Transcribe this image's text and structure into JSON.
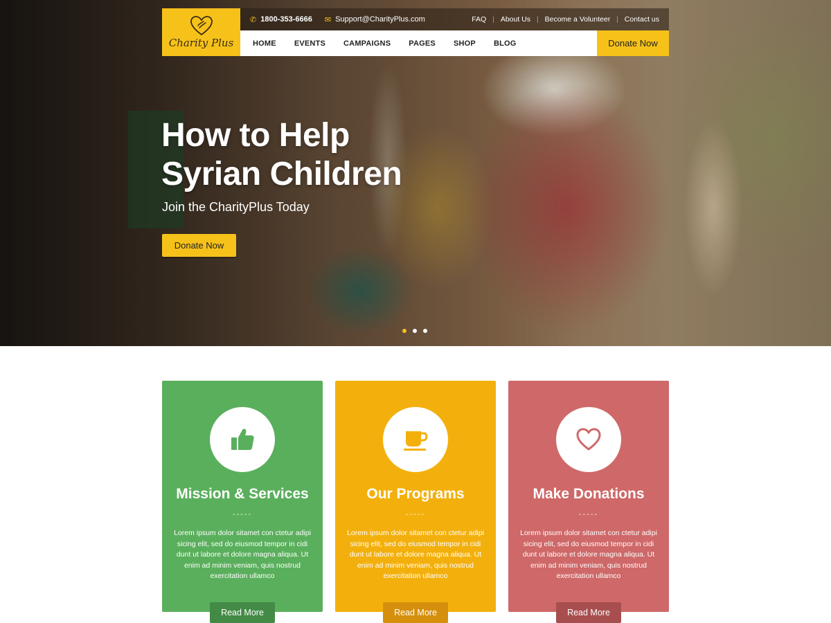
{
  "brand": {
    "logo_text": "Charity Plus",
    "accent_color": "#f6c21a"
  },
  "topbar": {
    "phone": "1800-353-6666",
    "email": "Support@CharityPlus.com",
    "links": [
      "FAQ",
      "About Us",
      "Become a Volunteer",
      "Contact us"
    ]
  },
  "nav": {
    "items": [
      "HOME",
      "EVENTS",
      "CAMPAIGNS",
      "PAGES",
      "SHOP",
      "BLOG"
    ],
    "donate_label": "Donate Now"
  },
  "hero": {
    "title_line1": "How to Help",
    "title_line2": "Syrian Children",
    "subtitle": "Join the CharityPlus Today",
    "button_label": "Donate Now",
    "slides_count": 3,
    "active_slide": 1
  },
  "cards": [
    {
      "title": "Mission & Services",
      "divider": "-----",
      "text": "Lorem ipsum dolor sitamet con ctetur adipi sicing elit, sed do eiusmod tempor in cidi dunt ut labore et dolore magna aliqua. Ut enim ad minim veniam, quis nostrud exercitation ullamco",
      "button_label": "Read More",
      "icon": "thumbs-up-icon",
      "color": "#5aaf5c"
    },
    {
      "title": "Our Programs",
      "divider": "-----",
      "text": "Lorem ipsum dolor sitamet con ctetur adipi sicing elit, sed do eiusmod tempor in cidi dunt ut labore et dolore magna aliqua. Ut enim ad minim veniam, quis nostrud exercitation ullamco",
      "button_label": "Read More",
      "icon": "coffee-cup-icon",
      "color": "#f3b00d"
    },
    {
      "title": "Make Donations",
      "divider": "-----",
      "text": "Lorem ipsum dolor sitamet con ctetur adipi sicing elit, sed do eiusmod tempor in cidi dunt ut labore et dolore magna aliqua. Ut enim ad minim veniam, quis nostrud exercitation ullamco",
      "button_label": "Read More",
      "icon": "heart-icon",
      "color": "#cf6868"
    }
  ]
}
